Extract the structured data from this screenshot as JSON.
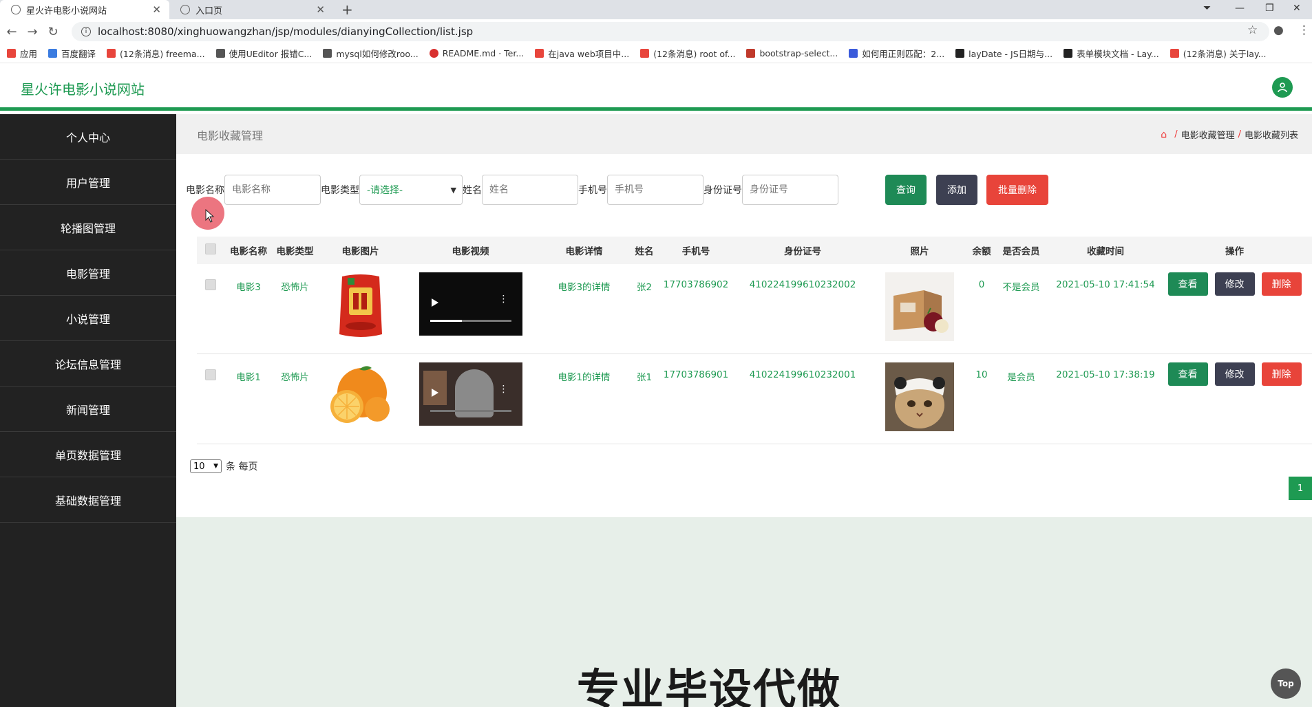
{
  "browser": {
    "tabs": [
      {
        "label": "星火许电影小说网站",
        "active": true
      },
      {
        "label": "入口页",
        "active": false
      }
    ],
    "url": "localhost:8080/xinghuowangzhan/jsp/modules/dianyingCollection/list.jsp",
    "bookmarks": [
      {
        "label": "应用",
        "color": "#e8453c"
      },
      {
        "label": "百度翻译",
        "color": "#3b7ce0"
      },
      {
        "label": "(12条消息) freema...",
        "color": "#e8453c"
      },
      {
        "label": "使用UEditor 报错C...",
        "color": "#555555"
      },
      {
        "label": "mysql如何修改roo...",
        "color": "#555555"
      },
      {
        "label": "README.md · Ter...",
        "color": "#d8302f"
      },
      {
        "label": "在java web项目中...",
        "color": "#e8453c"
      },
      {
        "label": "(12条消息) root of...",
        "color": "#e8453c"
      },
      {
        "label": "bootstrap-select...",
        "color": "#c0392b"
      },
      {
        "label": "如何用正则匹配：2...",
        "color": "#3b5bdb"
      },
      {
        "label": "layDate - JS日期与...",
        "color": "#222222"
      },
      {
        "label": "表单模块文档 - Lay...",
        "color": "#222222"
      },
      {
        "label": "(12条消息) 关于lay...",
        "color": "#e8453c"
      }
    ]
  },
  "header": {
    "site_title": "星火许电影小说网站"
  },
  "sidebar": {
    "items": [
      {
        "label": "个人中心"
      },
      {
        "label": "用户管理"
      },
      {
        "label": "轮播图管理"
      },
      {
        "label": "电影管理"
      },
      {
        "label": "小说管理"
      },
      {
        "label": "论坛信息管理"
      },
      {
        "label": "新闻管理"
      },
      {
        "label": "单页数据管理"
      },
      {
        "label": "基础数据管理"
      }
    ]
  },
  "page": {
    "title": "电影收藏管理",
    "breadcrumb": [
      "电影收藏管理",
      "电影收藏列表"
    ]
  },
  "search": {
    "name_label": "电影名称",
    "name_placeholder": "电影名称",
    "type_label": "电影类型",
    "type_value": "-请选择-",
    "user_label": "姓名",
    "user_placeholder": "姓名",
    "phone_label": "手机号",
    "phone_placeholder": "手机号",
    "id_label": "身份证号",
    "id_placeholder": "身份证号",
    "query_btn": "查询",
    "add_btn": "添加",
    "batch_delete_btn": "批量删除"
  },
  "table": {
    "headers": [
      "电影名称",
      "电影类型",
      "电影图片",
      "电影视频",
      "电影详情",
      "姓名",
      "手机号",
      "身份证号",
      "照片",
      "余额",
      "是否会员",
      "收藏时间",
      "操作"
    ],
    "rows": [
      {
        "name": "电影3",
        "type": "恐怖片",
        "image": "rice-bag",
        "video_progress": 0.39,
        "detail": "电影3的详情",
        "user": "张2",
        "phone": "17703786902",
        "id_card": "410224199610232002",
        "photo": "gift-box-apple",
        "balance": "0",
        "member": "不是会员",
        "time": "2021-05-10 17:41:54"
      },
      {
        "name": "电影1",
        "type": "恐怖片",
        "image": "oranges",
        "video_progress": 0.0,
        "detail": "电影1的详情",
        "user": "张1",
        "phone": "17703786901",
        "id_card": "410224199610232001",
        "photo": "cat",
        "balance": "10",
        "member": "是会员",
        "time": "2021-05-10 17:38:19"
      }
    ],
    "ops": {
      "view": "查看",
      "edit": "修改",
      "delete": "删除"
    }
  },
  "pagination": {
    "page_size": "10",
    "page_size_suffix": "条 每页",
    "current_page": "1"
  },
  "banner": "专业毕设代做",
  "top_button": "Top",
  "colors": {
    "accent": "#1e9a52",
    "danger": "#e8443a",
    "dark": "#3d4052",
    "sidebar": "#222222"
  }
}
